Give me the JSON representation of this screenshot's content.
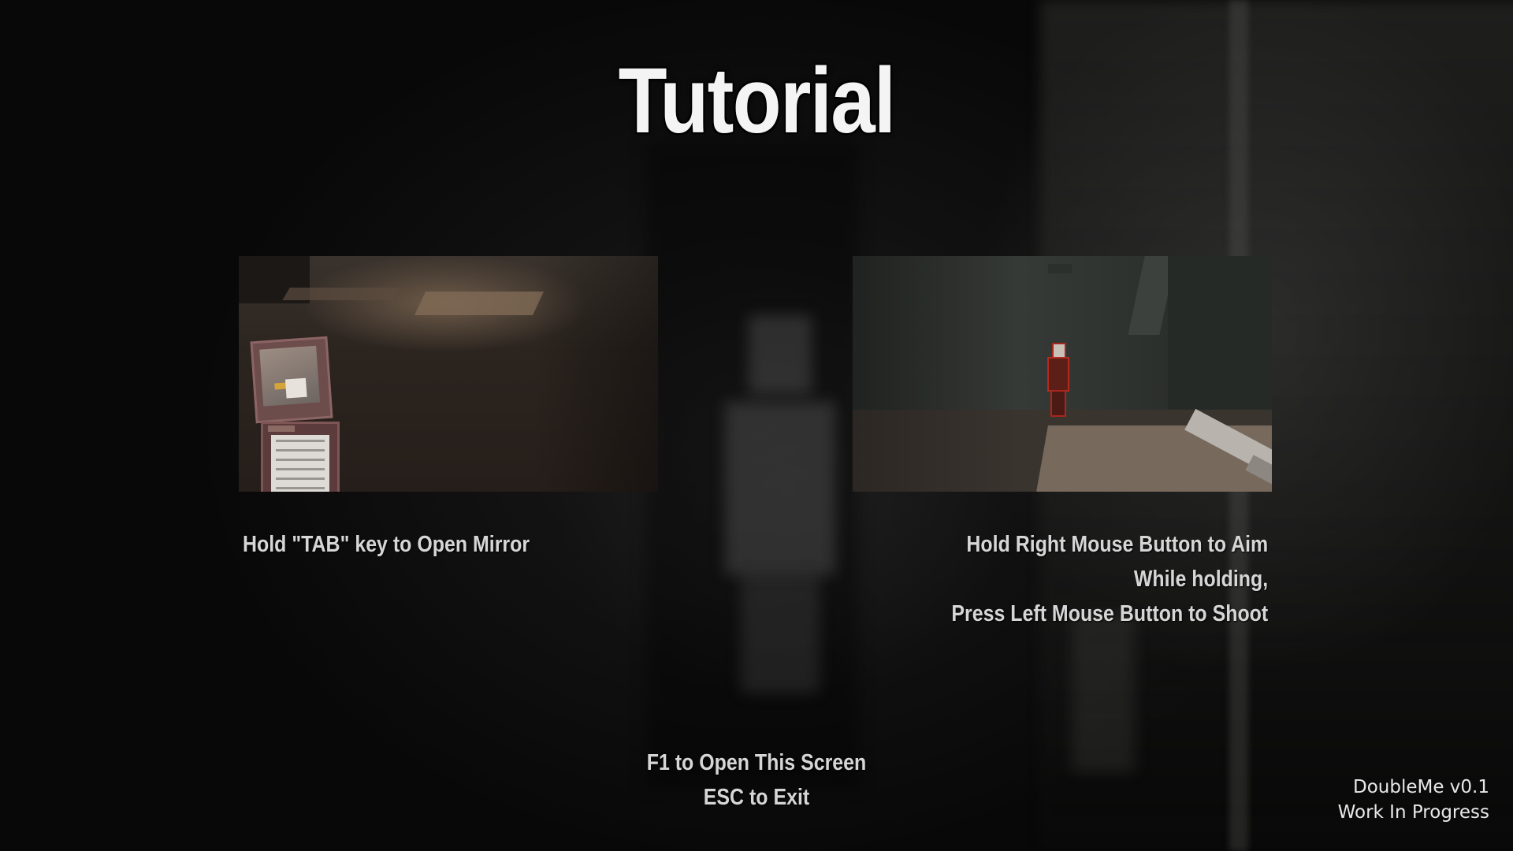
{
  "title": "Tutorial",
  "panels": {
    "mirror": {
      "caption": "Hold \"TAB\" key to Open Mirror"
    },
    "aim": {
      "caption_lines": [
        "Hold Right Mouse Button to Aim",
        "While holding,",
        "Press Left Mouse Button to Shoot"
      ]
    }
  },
  "footer": {
    "lines": [
      "F1 to Open This Screen",
      "ESC to Exit"
    ]
  },
  "version": {
    "name": "DoubleMe v0.1",
    "status": "Work In Progress"
  }
}
